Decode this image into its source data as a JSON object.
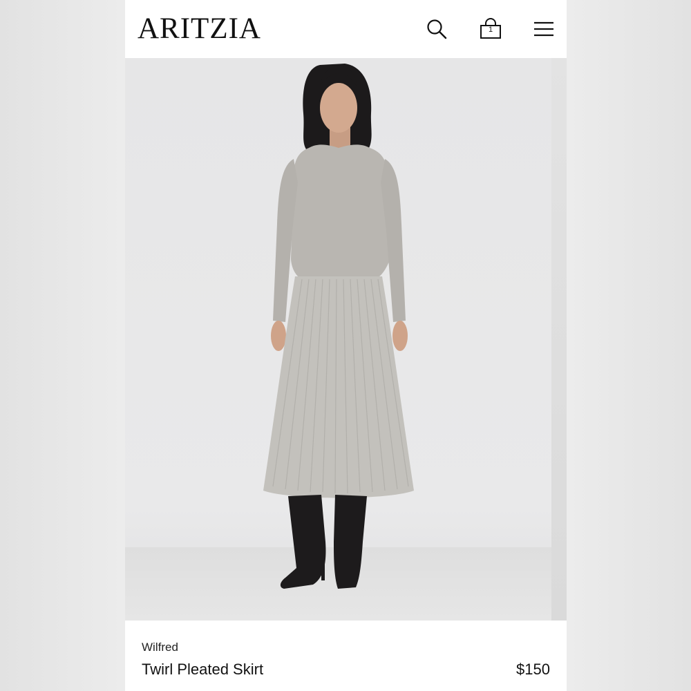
{
  "header": {
    "logo_text": "ARITZIA",
    "search_icon": "search-icon",
    "bag_icon": "shopping-bag-icon",
    "bag_count": "1",
    "menu_icon": "hamburger-menu-icon"
  },
  "product": {
    "image_alt": "",
    "brand": "Wilfred",
    "name": "Twirl Pleated Skirt",
    "price": "$150"
  },
  "colors": {
    "background": "#ffffff",
    "text": "#111111",
    "photo_bg": "#e8e8e9"
  }
}
